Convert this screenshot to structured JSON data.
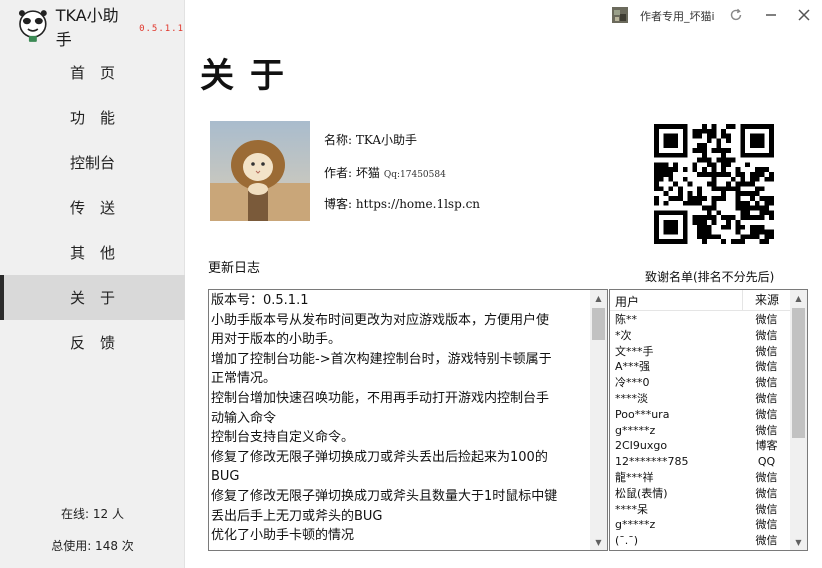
{
  "app": {
    "title": "TKA小助手",
    "version": "0.5.1.1",
    "logo_icon": "panda-meme-icon"
  },
  "titlebar": {
    "user_name": "作者专用_坏猫i",
    "refresh_icon": "refresh-icon",
    "minimize_icon": "minimize-icon",
    "close_icon": "close-icon"
  },
  "sidebar": {
    "items": [
      {
        "label": "首　页",
        "active": false
      },
      {
        "label": "功　能",
        "active": false
      },
      {
        "label": "控制台",
        "active": false
      },
      {
        "label": "传　送",
        "active": false
      },
      {
        "label": "其　他",
        "active": false
      },
      {
        "label": "关　于",
        "active": true
      },
      {
        "label": "反　馈",
        "active": false
      }
    ],
    "stats": {
      "online": "在线: 12 人",
      "total": "总使用: 148 次"
    }
  },
  "page": {
    "title": "关于",
    "info": {
      "name": "名称: TKA小助手",
      "author": "作者: 坏猫",
      "qq": "Qq:17450584",
      "blog": "博客: https://home.1lsp.cn"
    },
    "log_title": "更新日志",
    "log_lines": [
      "版本号：0.5.1.1",
      "小助手版本号从发布时间更改为对应游戏版本，方便用户使",
      "用对于版本的小助手。",
      "增加了控制台功能->首次构建控制台时，游戏特别卡顿属于",
      "正常情况。",
      "控制台增加快速召唤功能，不用再手动打开游戏内控制台手",
      "动输入命令",
      "控制台支持自定义命令。",
      "修复了修改无限子弹切换成刀或斧头丢出后捡起来为100的",
      "BUG",
      "修复了修改无限子弹切换成刀或斧头且数量大于1时鼠标中键",
      "丢出后手上无刀或斧头的BUG",
      "优化了小助手卡顿的情况"
    ],
    "log_scroll_fraction": 0.0,
    "thanks_title": "致谢名单(排名不分先后)",
    "thanks_headers": {
      "user": "用户",
      "source": "来源"
    },
    "thanks_rows": [
      {
        "user": "陈**",
        "source": "微信"
      },
      {
        "user": "*次",
        "source": "微信"
      },
      {
        "user": "文***手",
        "source": "微信"
      },
      {
        "user": "A***强",
        "source": "微信"
      },
      {
        "user": "冷***0",
        "source": "微信"
      },
      {
        "user": "****淡",
        "source": "微信"
      },
      {
        "user": "Poo***ura",
        "source": "微信"
      },
      {
        "user": "g*****z",
        "source": "微信"
      },
      {
        "user": "2CI9uxgo",
        "source": "博客"
      },
      {
        "user": "12*******785",
        "source": "QQ"
      },
      {
        "user": "龍***祥",
        "source": "微信"
      },
      {
        "user": "松鼠(表情)",
        "source": "微信"
      },
      {
        "user": "****呆",
        "source": "微信"
      },
      {
        "user": "g*****z",
        "source": "微信"
      },
      {
        "user": "(ˉ.ˉ)",
        "source": "微信"
      }
    ]
  },
  "colors": {
    "version": "#e0362b",
    "sidebar_bg": "#f0f0f0",
    "active_bg": "#d9d9d9",
    "active_bar": "#2b2b2b"
  }
}
